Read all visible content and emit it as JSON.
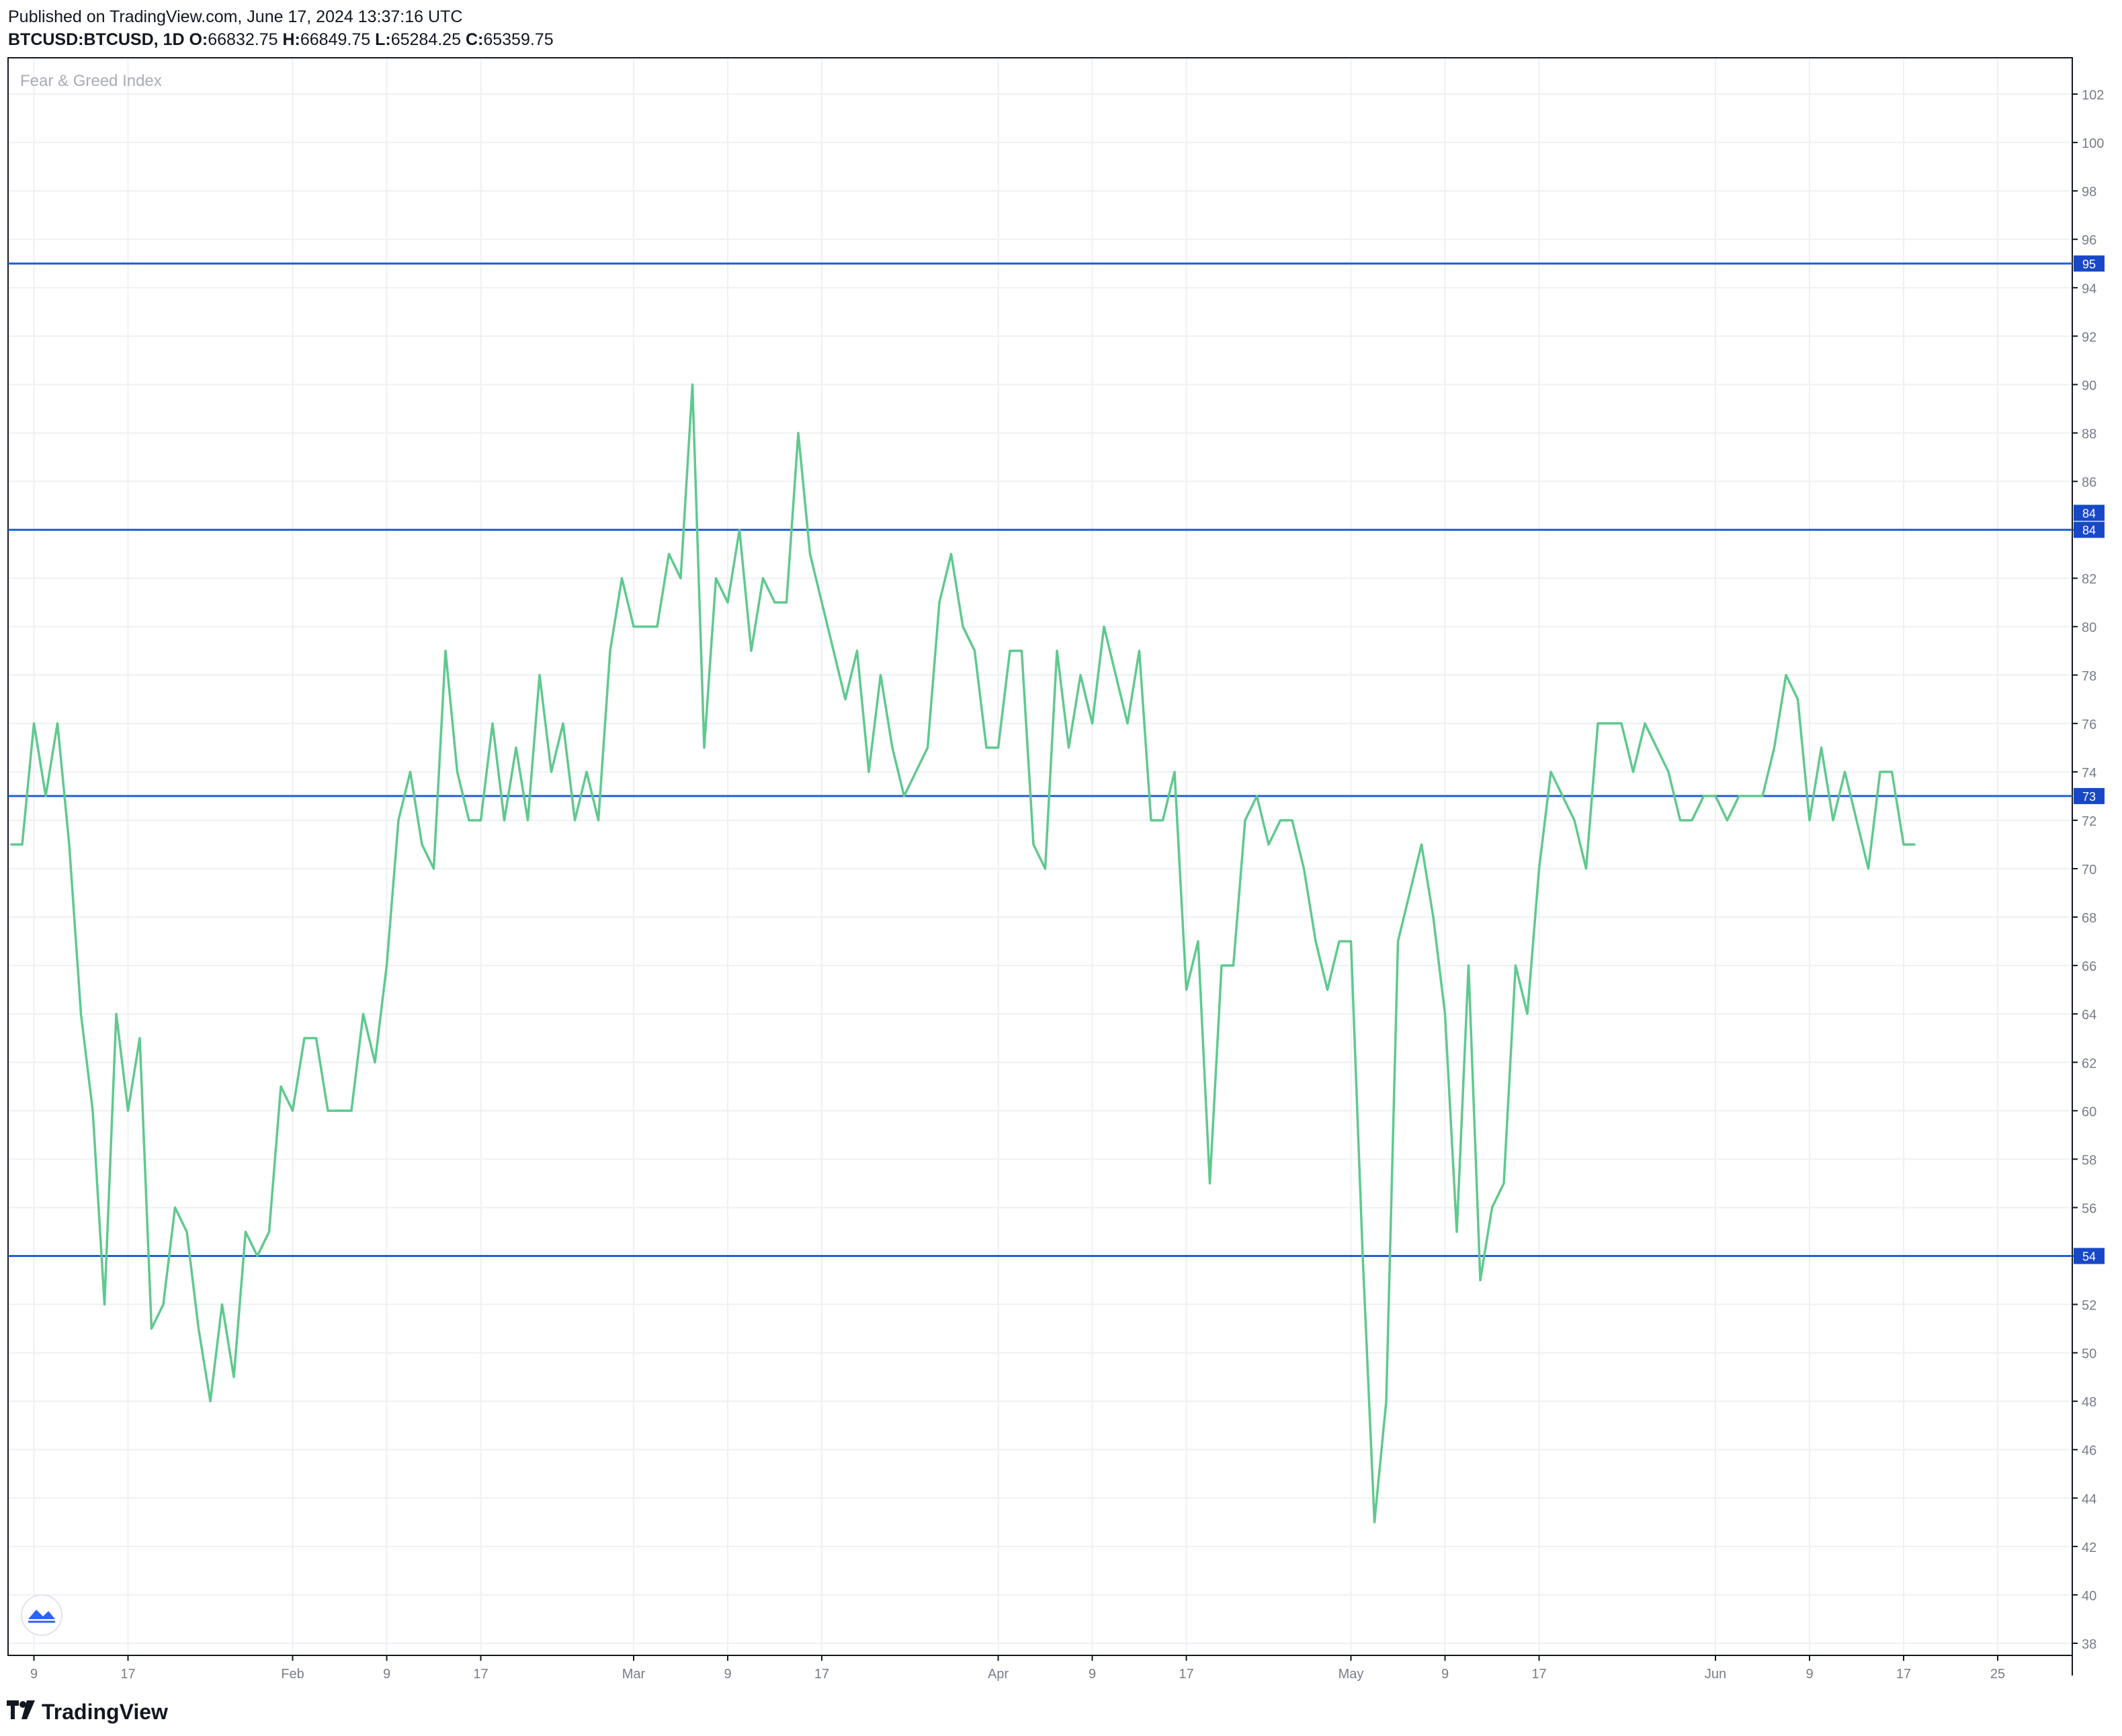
{
  "header": {
    "published": "Published on TradingView.com, June 17, 2024 13:37:16 UTC",
    "symbol": "BTCUSD:BTCUSD, 1D",
    "o_label": "O:",
    "o_value": "66832.75",
    "h_label": "H:",
    "h_value": "66849.75",
    "l_label": "L:",
    "l_value": "65284.25",
    "c_label": "C:",
    "c_value": "65359.75"
  },
  "footer": {
    "brand": "TradingView",
    "logo_icon": "tradingview-logo-icon"
  },
  "chart_icon": "tradingview-cloud-icon",
  "colors": {
    "series": "#5fc98e",
    "hline": "#1e5fd8",
    "grid": "#eef0f3",
    "axis_text": "#777c87",
    "badge": "#1848c8"
  },
  "chart_data": {
    "type": "line",
    "title": "Fear & Greed Index",
    "ylim": [
      37.5,
      103.5
    ],
    "grid": true,
    "y_ticks": [
      38,
      40,
      42,
      44,
      46,
      48,
      50,
      52,
      54,
      56,
      58,
      60,
      62,
      64,
      66,
      68,
      70,
      72,
      74,
      76,
      78,
      80,
      82,
      84,
      86,
      88,
      90,
      92,
      94,
      96,
      98,
      100,
      102
    ],
    "x_ticks": [
      {
        "label": "9",
        "day": 9
      },
      {
        "label": "17",
        "day": 17
      },
      {
        "label": "Feb",
        "day": 31
      },
      {
        "label": "9",
        "day": 39
      },
      {
        "label": "17",
        "day": 47
      },
      {
        "label": "Mar",
        "day": 60
      },
      {
        "label": "9",
        "day": 68
      },
      {
        "label": "17",
        "day": 76
      },
      {
        "label": "Apr",
        "day": 91
      },
      {
        "label": "9",
        "day": 99
      },
      {
        "label": "17",
        "day": 107
      },
      {
        "label": "May",
        "day": 121
      },
      {
        "label": "9",
        "day": 129
      },
      {
        "label": "17",
        "day": 137
      },
      {
        "label": "Jun",
        "day": 152
      },
      {
        "label": "9",
        "day": 160
      },
      {
        "label": "17",
        "day": 168
      },
      {
        "label": "25",
        "day": 176
      }
    ],
    "horizontal_lines": [
      95,
      84,
      73,
      54
    ],
    "badges": [
      {
        "label": "95",
        "value": 95
      },
      {
        "label": "84",
        "value": 84.7
      },
      {
        "label": "84",
        "value": 84
      },
      {
        "label": "73",
        "value": 73
      },
      {
        "label": "54",
        "value": 54
      }
    ],
    "series": [
      {
        "start_day": 7,
        "values": [
          71,
          71,
          76,
          73,
          76,
          71,
          64,
          60,
          52,
          64,
          60,
          63,
          51,
          52,
          56,
          55,
          51,
          48,
          52,
          49,
          55,
          54,
          55,
          61,
          60,
          63,
          63,
          60,
          60,
          60,
          64,
          62,
          66,
          72,
          74,
          71,
          70,
          79,
          74,
          72,
          72,
          76,
          72,
          75,
          72,
          78,
          74,
          76,
          72,
          74,
          72,
          79,
          82,
          80,
          80,
          80,
          83,
          82,
          90,
          75,
          82,
          81,
          84,
          79,
          82,
          81,
          81,
          88,
          83,
          81,
          79,
          77,
          79,
          74,
          78,
          75,
          73,
          74,
          75,
          81,
          83,
          80,
          79,
          75,
          75,
          79,
          79,
          71,
          70,
          79,
          75,
          78,
          76,
          80,
          78,
          76,
          79,
          72,
          72,
          74,
          65,
          67,
          57,
          66,
          66,
          72,
          73,
          71,
          72,
          72,
          70,
          67,
          65,
          67,
          67,
          54,
          43,
          48,
          67,
          69,
          71,
          68,
          64,
          55,
          66,
          53,
          56,
          57,
          66,
          64,
          70,
          74,
          73,
          72,
          70,
          76,
          76,
          76,
          74,
          76,
          75,
          74,
          72,
          72,
          73,
          73,
          72,
          73,
          73,
          73,
          75,
          78,
          77,
          72,
          75,
          72,
          74,
          72,
          70,
          74,
          74,
          71,
          71
        ]
      }
    ]
  }
}
